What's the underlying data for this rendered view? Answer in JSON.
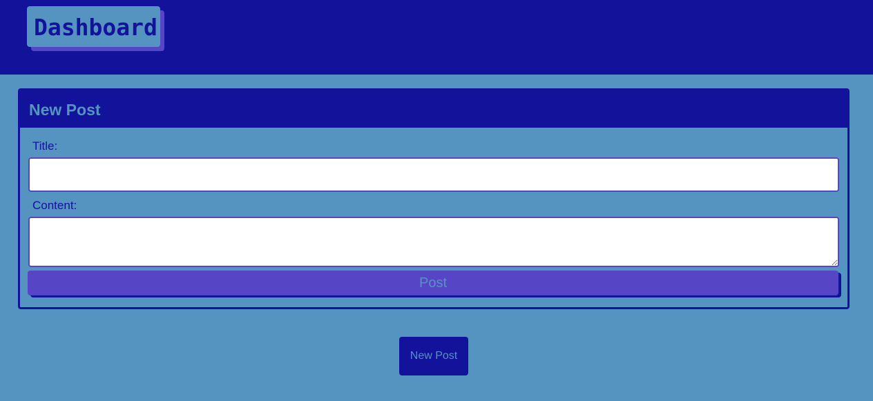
{
  "header": {
    "logo_text": "Dashboard"
  },
  "new_post_form": {
    "title": "New Post",
    "title_label": "Title:",
    "title_value": "",
    "content_label": "Content:",
    "content_value": "",
    "submit_label": "Post"
  },
  "actions": {
    "new_post_label": "New Post"
  },
  "colors": {
    "primary": "#12129b",
    "background": "#5593c1",
    "accent": "#5646c5",
    "input_background": "#ffffff"
  }
}
